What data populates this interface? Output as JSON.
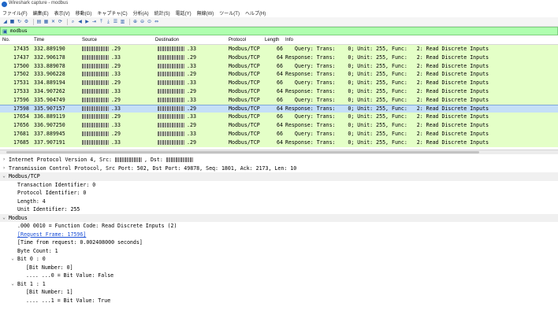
{
  "window": {
    "title": "Wireshark capture - modbus"
  },
  "menu": [
    "ファイル(F)",
    "編集(E)",
    "表示(V)",
    "移動(G)",
    "キャプチャ(C)",
    "分析(A)",
    "統計(S)",
    "電話(Y)",
    "無線(W)",
    "ツール(T)",
    "ヘルプ(H)"
  ],
  "toolbar": {
    "buttons": [
      "shark-fin-icon",
      "stop-icon",
      "restart-icon",
      "options-icon",
      "open-icon",
      "save-icon",
      "close-file-icon",
      "reload-icon",
      "find-icon",
      "back-icon",
      "forward-icon",
      "go-to-icon",
      "first-icon",
      "last-icon",
      "autoscroll-icon",
      "colorize-icon",
      "zoom-in-icon",
      "zoom-out-icon",
      "zoom-reset-icon",
      "resize-columns-icon"
    ]
  },
  "filter": {
    "value": "modbus"
  },
  "columns": {
    "no": "No.",
    "time": "Time",
    "source": "Source",
    "destination": "Destination",
    "protocol": "Protocol",
    "length": "Length",
    "info": "Info"
  },
  "packets": [
    {
      "no": "17435",
      "time": "332.889190",
      "src_suffix": ".29",
      "dst_suffix": ".33",
      "protocol": "Modbus/TCP",
      "length": "66",
      "info": "   Query: Trans:    0; Unit: 255, Func:   2: Read Discrete Inputs"
    },
    {
      "no": "17437",
      "time": "332.906178",
      "src_suffix": ".33",
      "dst_suffix": ".29",
      "protocol": "Modbus/TCP",
      "length": "64",
      "info": "Response: Trans:    0; Unit: 255, Func:   2: Read Discrete Inputs"
    },
    {
      "no": "17500",
      "time": "333.889078",
      "src_suffix": ".29",
      "dst_suffix": ".33",
      "protocol": "Modbus/TCP",
      "length": "66",
      "info": "   Query: Trans:    0; Unit: 255, Func:   2: Read Discrete Inputs"
    },
    {
      "no": "17502",
      "time": "333.906228",
      "src_suffix": ".33",
      "dst_suffix": ".29",
      "protocol": "Modbus/TCP",
      "length": "64",
      "info": "Response: Trans:    0; Unit: 255, Func:   2: Read Discrete Inputs"
    },
    {
      "no": "17531",
      "time": "334.889194",
      "src_suffix": ".29",
      "dst_suffix": ".33",
      "protocol": "Modbus/TCP",
      "length": "66",
      "info": "   Query: Trans:    0; Unit: 255, Func:   2: Read Discrete Inputs"
    },
    {
      "no": "17533",
      "time": "334.907262",
      "src_suffix": ".33",
      "dst_suffix": ".29",
      "protocol": "Modbus/TCP",
      "length": "64",
      "info": "Response: Trans:    0; Unit: 255, Func:   2: Read Discrete Inputs"
    },
    {
      "no": "17596",
      "time": "335.904749",
      "src_suffix": ".29",
      "dst_suffix": ".33",
      "protocol": "Modbus/TCP",
      "length": "66",
      "info": "   Query: Trans:    0; Unit: 255, Func:   2: Read Discrete Inputs"
    },
    {
      "no": "17598",
      "time": "335.907157",
      "src_suffix": ".33",
      "dst_suffix": ".29",
      "protocol": "Modbus/TCP",
      "length": "64",
      "info": "Response: Trans:    0; Unit: 255, Func:   2: Read Discrete Inputs",
      "selected": true
    },
    {
      "no": "17654",
      "time": "336.889119",
      "src_suffix": ".29",
      "dst_suffix": ".33",
      "protocol": "Modbus/TCP",
      "length": "66",
      "info": "   Query: Trans:    0; Unit: 255, Func:   2: Read Discrete Inputs"
    },
    {
      "no": "17656",
      "time": "336.907250",
      "src_suffix": ".33",
      "dst_suffix": ".29",
      "protocol": "Modbus/TCP",
      "length": "64",
      "info": "Response: Trans:    0; Unit: 255, Func:   2: Read Discrete Inputs"
    },
    {
      "no": "17681",
      "time": "337.889945",
      "src_suffix": ".29",
      "dst_suffix": ".33",
      "protocol": "Modbus/TCP",
      "length": "66",
      "info": "   Query: Trans:    0; Unit: 255, Func:   2: Read Discrete Inputs"
    },
    {
      "no": "17685",
      "time": "337.907191",
      "src_suffix": ".33",
      "dst_suffix": ".29",
      "protocol": "Modbus/TCP",
      "length": "64",
      "info": "Response: Trans:    0; Unit: 255, Func:   2: Read Discrete Inputs"
    }
  ],
  "details": {
    "ip_line": "Internet Protocol Version 4, Src:",
    "ip_dst": ", Dst:",
    "tcp_line": "Transmission Control Protocol, Src Port: 502, Dst Port: 49878, Seq: 1801, Ack: 2173, Len: 10",
    "mbtcp_header": "Modbus/TCP",
    "transaction": "Transaction Identifier: 0",
    "protocol_id": "Protocol Identifier: 0",
    "length": "Length: 4",
    "unit": "Unit Identifier: 255",
    "modbus_header": "Modbus",
    "func": ".000 0010 = Function Code: Read Discrete Inputs (2)",
    "request_frame": "[Request Frame: 17596]",
    "time_from_request": "[Time from request: 0.002408000 seconds]",
    "byte_count": "Byte Count: 1",
    "bit0": "Bit 0 : 0",
    "bit0_number": "[Bit Number: 0]",
    "bit0_value": ".... ...0 = Bit Value: False",
    "bit1": "Bit 1 : 1",
    "bit1_number": "[Bit Number: 1]",
    "bit1_value": ".... ...1 = Bit Value: True"
  },
  "colors": {
    "row_bg": "#e4ffc7",
    "selected_bg": "#c5dff7",
    "filter_bg": "#afffaf",
    "link": "#1b4fd6"
  }
}
